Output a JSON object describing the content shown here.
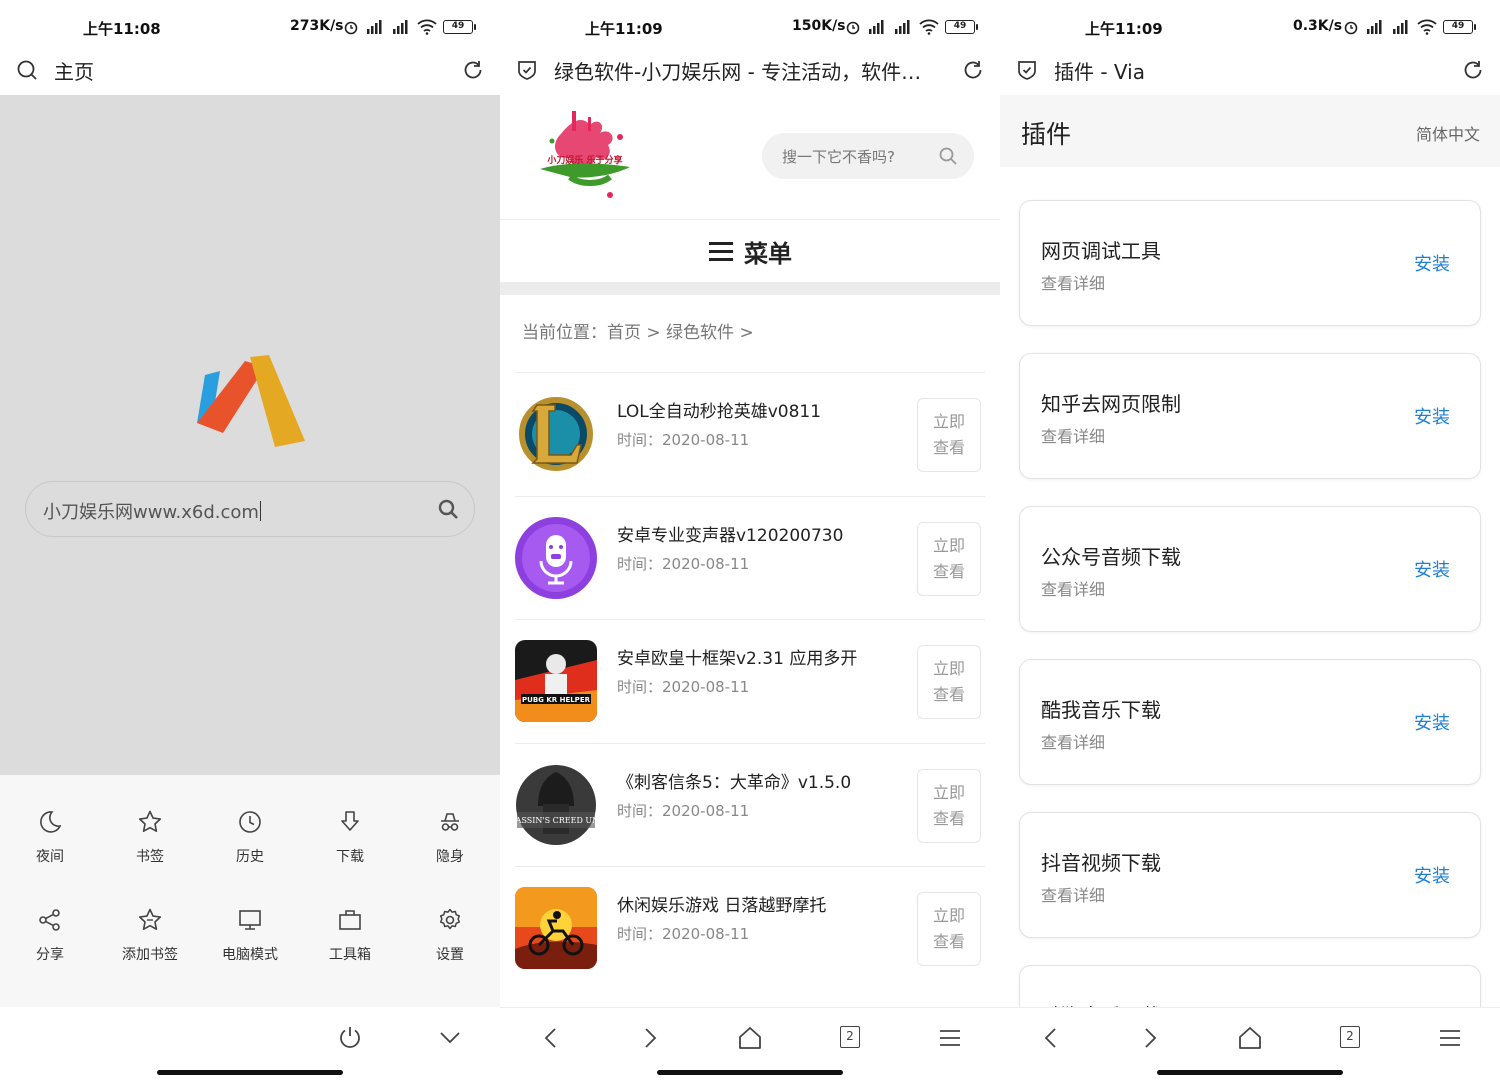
{
  "panel1": {
    "status": {
      "time": "上午11:08",
      "speed": "273K/s",
      "battery": "49"
    },
    "address_title": "主页",
    "search_value": "小刀娱乐网www.x6d.com",
    "menu_items": [
      {
        "label": "夜间",
        "icon": "moon-icon"
      },
      {
        "label": "书签",
        "icon": "star-icon"
      },
      {
        "label": "历史",
        "icon": "clock-icon"
      },
      {
        "label": "下载",
        "icon": "download-icon"
      },
      {
        "label": "隐身",
        "icon": "incognito-icon"
      },
      {
        "label": "分享",
        "icon": "share-icon"
      },
      {
        "label": "添加书签",
        "icon": "star-add-icon"
      },
      {
        "label": "电脑模式",
        "icon": "monitor-icon"
      },
      {
        "label": "工具箱",
        "icon": "toolbox-icon"
      },
      {
        "label": "设置",
        "icon": "gear-icon"
      }
    ]
  },
  "panel2": {
    "status": {
      "time": "上午11:09",
      "speed": "150K/s",
      "battery": "49"
    },
    "address_title": "绿色软件-小刀娱乐网 - 专注活动，软件…",
    "logo_text": "小刀娱乐 乐于分享",
    "search_placeholder": "搜一下它不香吗?",
    "menu_label": "菜单",
    "breadcrumb": "当前位置：首页 > 绿色软件 >",
    "items": [
      {
        "title": "LOL全自动秒抢英雄v0811",
        "date": "时间：2020-08-11",
        "button_line1": "立即",
        "button_line2": "查看"
      },
      {
        "title": "安卓专业变声器v120200730",
        "date": "时间：2020-08-11",
        "button_line1": "立即",
        "button_line2": "查看"
      },
      {
        "title": "安卓欧皇十框架v2.31 应用多开",
        "date": "时间：2020-08-11",
        "button_line1": "立即",
        "button_line2": "查看",
        "thumb_text": "PUBG KR HELPER"
      },
      {
        "title": "《刺客信条5：大革命》v1.5.0",
        "date": "时间：2020-08-11",
        "button_line1": "立即",
        "button_line2": "查看",
        "thumb_text": "ASSASSIN'S CREED UNITY"
      },
      {
        "title": "休闲娱乐游戏 日落越野摩托",
        "date": "时间：2020-08-11",
        "button_line1": "立即",
        "button_line2": "查看"
      }
    ],
    "tab_count": "2"
  },
  "panel3": {
    "status": {
      "time": "上午11:09",
      "speed": "0.3K/s",
      "battery": "49"
    },
    "address_title": "插件 - Via",
    "header_title": "插件",
    "language": "简体中文",
    "plugins": [
      {
        "name": "网页调试工具",
        "detail": "查看详细",
        "action": "安装"
      },
      {
        "name": "知乎去网页限制",
        "detail": "查看详细",
        "action": "安装"
      },
      {
        "name": "公众号音频下载",
        "detail": "查看详细",
        "action": "安装"
      },
      {
        "name": "酷我音乐下载",
        "detail": "查看详细",
        "action": "安装"
      },
      {
        "name": "抖音视频下载",
        "detail": "查看详细",
        "action": "安装"
      },
      {
        "name": "酷狗音乐下载",
        "detail": "",
        "action": ""
      }
    ],
    "tab_count": "2"
  },
  "colors": {
    "accent_blue": "#1f7fd6",
    "home_bg": "#dcdcdc"
  }
}
